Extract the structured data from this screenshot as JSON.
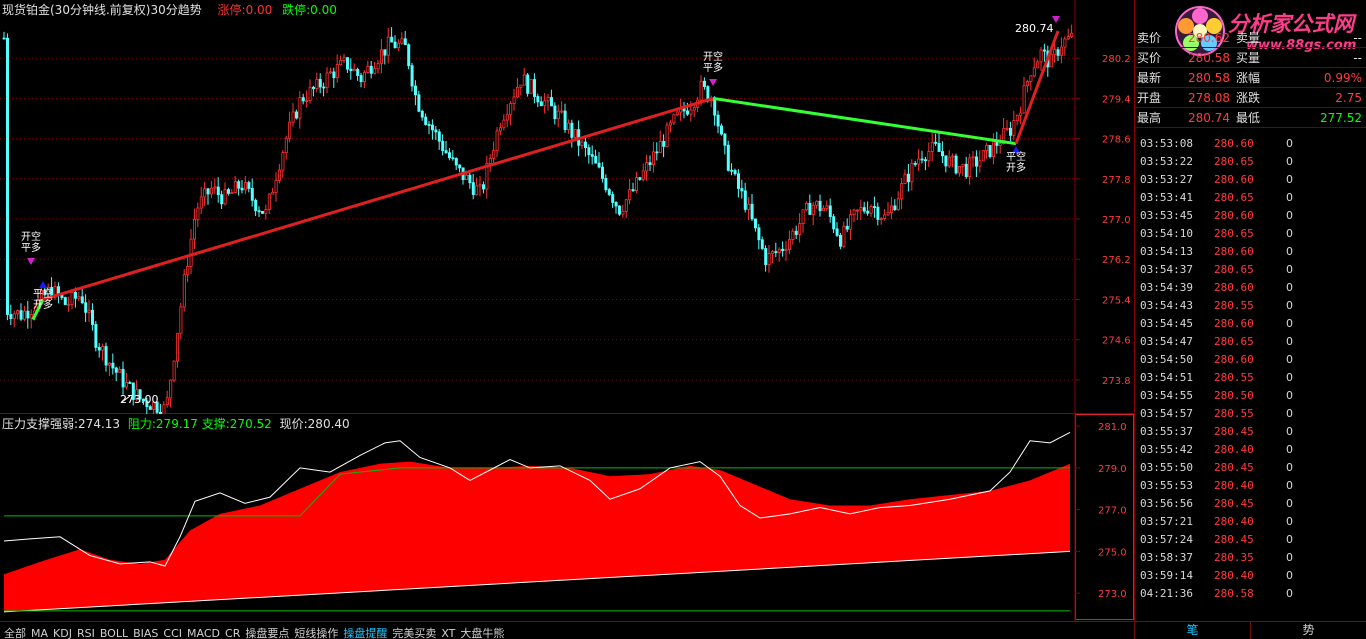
{
  "header": {
    "title": "现货铂金(30分钟线.前复权)30分趋势",
    "limit_up": "涨停:0.00",
    "limit_down": "跌停:0.00"
  },
  "main_chart": {
    "price_labels": [
      "280.2",
      "279.4",
      "278.6",
      "277.8",
      "277.0",
      "276.2",
      "275.4",
      "274.6",
      "273.8"
    ],
    "high_label": "280.74",
    "low_label": "273.00",
    "signals": [
      {
        "lines": [
          "开空",
          "平多"
        ]
      },
      {
        "lines": [
          "平空",
          "开多"
        ]
      },
      {
        "lines": [
          "开空",
          "平多"
        ]
      },
      {
        "lines": [
          "平空",
          "开多"
        ]
      }
    ]
  },
  "indicator": {
    "title": "压力支撑强弱:274.13",
    "resistance": "阻力:279.17",
    "support": "支撑:270.52",
    "price": "现价:280.40",
    "axis_labels": [
      "281.0",
      "279.0",
      "277.0",
      "275.0",
      "273.0"
    ]
  },
  "chart_data": {
    "type": "candlestick",
    "title": "现货铂金(30分钟线.前复权)30分趋势",
    "ylim": [
      273.4,
      280.8
    ],
    "y_ticks": [
      280.2,
      279.4,
      278.6,
      277.8,
      277.0,
      276.2,
      275.4,
      274.6,
      273.8
    ],
    "annotated_high": 280.74,
    "annotated_low": 273.0,
    "trend_lines": [
      {
        "from": 275.0,
        "to": 275.4,
        "color": "green"
      },
      {
        "from": 275.4,
        "to": 279.4,
        "color": "red"
      },
      {
        "from": 279.4,
        "to": 278.5,
        "color": "green"
      },
      {
        "from": 278.5,
        "to": 280.74,
        "color": "red"
      }
    ],
    "indicator": {
      "ylim": [
        272.0,
        281.2
      ],
      "ticks": [
        281.0,
        279.0,
        277.0,
        275.0,
        273.0
      ],
      "pressure_support_strength": 274.13,
      "resistance": 279.17,
      "support": 270.52,
      "current_price": 280.4
    }
  },
  "quote": {
    "sell_label": "卖价",
    "sell_value": "280.62",
    "sell_vol_label": "卖量",
    "sell_vol": "--",
    "buy_label": "买价",
    "buy_value": "280.58",
    "buy_vol_label": "买量",
    "buy_vol": "--",
    "last_label": "最新",
    "last_value": "280.58",
    "chg_pct_label": "涨幅",
    "chg_pct": "0.99%",
    "open_label": "开盘",
    "open_value": "278.08",
    "chg_label": "涨跌",
    "chg": "2.75",
    "high_label": "最高",
    "high_value": "280.74",
    "low_label": "最低",
    "low_value": "277.52"
  },
  "ticks": [
    {
      "time": "03:53:08",
      "price": "280.60",
      "vol": "0",
      "dir": "up"
    },
    {
      "time": "03:53:22",
      "price": "280.65",
      "vol": "0",
      "dir": "up"
    },
    {
      "time": "03:53:27",
      "price": "280.60",
      "vol": "0",
      "dir": "up"
    },
    {
      "time": "03:53:41",
      "price": "280.65",
      "vol": "0",
      "dir": "up"
    },
    {
      "time": "03:53:45",
      "price": "280.60",
      "vol": "0",
      "dir": "up"
    },
    {
      "time": "03:54:10",
      "price": "280.65",
      "vol": "0",
      "dir": "up"
    },
    {
      "time": "03:54:13",
      "price": "280.60",
      "vol": "0",
      "dir": "up"
    },
    {
      "time": "03:54:37",
      "price": "280.65",
      "vol": "0",
      "dir": "up"
    },
    {
      "time": "03:54:39",
      "price": "280.60",
      "vol": "0",
      "dir": "up"
    },
    {
      "time": "03:54:43",
      "price": "280.55",
      "vol": "0",
      "dir": "up"
    },
    {
      "time": "03:54:45",
      "price": "280.60",
      "vol": "0",
      "dir": "up"
    },
    {
      "time": "03:54:47",
      "price": "280.65",
      "vol": "0",
      "dir": "up"
    },
    {
      "time": "03:54:50",
      "price": "280.60",
      "vol": "0",
      "dir": "up"
    },
    {
      "time": "03:54:51",
      "price": "280.55",
      "vol": "0",
      "dir": "up"
    },
    {
      "time": "03:54:55",
      "price": "280.50",
      "vol": "0",
      "dir": "up"
    },
    {
      "time": "03:54:57",
      "price": "280.55",
      "vol": "0",
      "dir": "up"
    },
    {
      "time": "03:55:37",
      "price": "280.45",
      "vol": "0",
      "dir": "up"
    },
    {
      "time": "03:55:42",
      "price": "280.40",
      "vol": "0",
      "dir": "up"
    },
    {
      "time": "03:55:50",
      "price": "280.45",
      "vol": "0",
      "dir": "up"
    },
    {
      "time": "03:55:53",
      "price": "280.40",
      "vol": "0",
      "dir": "up"
    },
    {
      "time": "03:56:56",
      "price": "280.45",
      "vol": "0",
      "dir": "up"
    },
    {
      "time": "03:57:21",
      "price": "280.40",
      "vol": "0",
      "dir": "up"
    },
    {
      "time": "03:57:24",
      "price": "280.45",
      "vol": "0",
      "dir": "up"
    },
    {
      "time": "03:58:37",
      "price": "280.35",
      "vol": "0",
      "dir": "up"
    },
    {
      "time": "03:59:14",
      "price": "280.40",
      "vol": "0",
      "dir": "up"
    },
    {
      "time": "04:21:36",
      "price": "280.58",
      "vol": "0",
      "dir": "up"
    }
  ],
  "watermark": {
    "site_name": "分析家公式网",
    "site_url": "www.88gs.com"
  },
  "tabs": [
    "全部",
    "MA",
    "KDJ",
    "RSI",
    "BOLL",
    "BIAS",
    "CCI",
    "MACD",
    "CR",
    "操盘要点",
    "短线操作",
    "操盘提醒",
    "完美买卖",
    "XT",
    "大盘牛熊"
  ],
  "active_tab_index": 11,
  "bottom_right_tabs": [
    "笔",
    "势"
  ],
  "colors": {
    "up": "#ff3232",
    "down": "#54ffff",
    "trend_up": "#e02020",
    "trend_down": "#33ff33",
    "grid": "#8b0000",
    "fill": "#ff0000",
    "label_red": "#ff3c3c",
    "label_green": "#00ff00"
  }
}
